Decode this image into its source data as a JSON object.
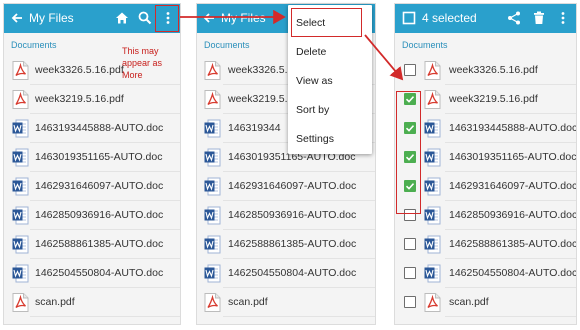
{
  "panel1": {
    "title": "My Files",
    "section": "Documents",
    "note": "This may appear as More",
    "icons": [
      "back-arrow-icon",
      "home-icon",
      "search-icon",
      "more-vert-icon"
    ],
    "files": [
      {
        "name": "week3326.5.16.pdf",
        "type": "pdf"
      },
      {
        "name": "week3219.5.16.pdf",
        "type": "pdf"
      },
      {
        "name": "1463193445888-AUTO.doc",
        "type": "doc"
      },
      {
        "name": "1463019351165-AUTO.doc",
        "type": "doc"
      },
      {
        "name": "1462931646097-AUTO.doc",
        "type": "doc"
      },
      {
        "name": "1462850936916-AUTO.doc",
        "type": "doc"
      },
      {
        "name": "1462588861385-AUTO.doc",
        "type": "doc"
      },
      {
        "name": "1462504550804-AUTO.doc",
        "type": "doc"
      },
      {
        "name": "scan.pdf",
        "type": "pdf"
      }
    ]
  },
  "panel2": {
    "title": "My Files",
    "section": "Documents",
    "files": [
      {
        "name": "week3326.5.16",
        "type": "pdf"
      },
      {
        "name": "week3219.5.16",
        "type": "pdf"
      },
      {
        "name": "146319344",
        "type": "doc"
      },
      {
        "name": "1463019351165-AUTO.doc",
        "type": "doc"
      },
      {
        "name": "1462931646097-AUTO.doc",
        "type": "doc"
      },
      {
        "name": "1462850936916-AUTO.doc",
        "type": "doc"
      },
      {
        "name": "1462588861385-AUTO.doc",
        "type": "doc"
      },
      {
        "name": "1462504550804-AUTO.doc",
        "type": "doc"
      },
      {
        "name": "scan.pdf",
        "type": "pdf"
      }
    ],
    "menu": [
      "Select",
      "Delete",
      "View as",
      "Sort by",
      "Settings"
    ]
  },
  "panel3": {
    "title": "4 selected",
    "section": "Documents",
    "icons": [
      "select-all-checkbox-icon",
      "share-icon",
      "delete-icon",
      "more-vert-icon"
    ],
    "files": [
      {
        "name": "week3326.5.16.pdf",
        "type": "pdf",
        "checked": false
      },
      {
        "name": "week3219.5.16.pdf",
        "type": "pdf",
        "checked": true
      },
      {
        "name": "1463193445888-AUTO.doc",
        "type": "doc",
        "checked": true
      },
      {
        "name": "1463019351165-AUTO.doc",
        "type": "doc",
        "checked": true
      },
      {
        "name": "1462931646097-AUTO.doc",
        "type": "doc",
        "checked": true
      },
      {
        "name": "1462850936916-AUTO.doc",
        "type": "doc",
        "checked": false
      },
      {
        "name": "1462588861385-AUTO.doc",
        "type": "doc",
        "checked": false
      },
      {
        "name": "1462504550804-AUTO.doc",
        "type": "doc",
        "checked": false
      },
      {
        "name": "scan.pdf",
        "type": "pdf",
        "checked": false
      }
    ]
  },
  "colors": {
    "appbar": "#2aa0cc",
    "accent_red": "#d22a2a",
    "check_green": "#4cae50",
    "pdf_red": "#d83b2f",
    "doc_blue": "#2b5797"
  }
}
